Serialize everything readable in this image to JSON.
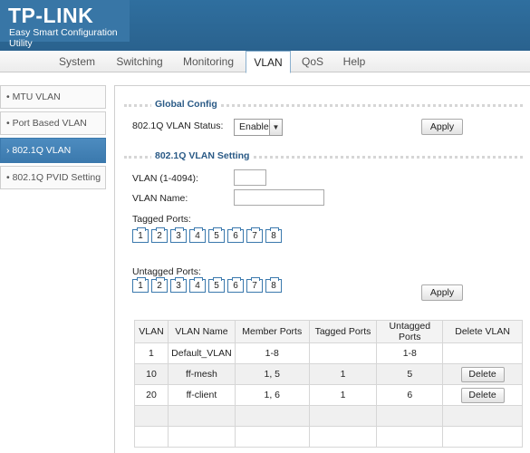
{
  "brand": {
    "logo": "TP-LINK",
    "subtitle": "Easy Smart Configuration Utility",
    "header_color": "#2f6f9f"
  },
  "tabs": [
    {
      "label": "System"
    },
    {
      "label": "Switching"
    },
    {
      "label": "Monitoring"
    },
    {
      "label": "VLAN",
      "active": true
    },
    {
      "label": "QoS"
    },
    {
      "label": "Help"
    }
  ],
  "menu": [
    {
      "label": "MTU VLAN"
    },
    {
      "label": "Port Based VLAN"
    },
    {
      "label": "802.1Q VLAN",
      "active": true
    },
    {
      "label": "802.1Q PVID Setting"
    }
  ],
  "global_config": {
    "title": "Global Config",
    "status_label": "802.1Q VLAN Status:",
    "status_value": "Enable",
    "apply_label": "Apply"
  },
  "vlan_setting": {
    "title": "802.1Q VLAN Setting",
    "vlan_id_label": "VLAN (1-4094):",
    "vlan_id_value": "",
    "vlan_name_label": "VLAN Name:",
    "vlan_name_value": "",
    "tagged_label": "Tagged Ports:",
    "untagged_label": "Untagged Ports:",
    "ports": [
      "1",
      "2",
      "3",
      "4",
      "5",
      "6",
      "7",
      "8"
    ],
    "apply_label": "Apply"
  },
  "table": {
    "headers": [
      "VLAN",
      "VLAN Name",
      "Member Ports",
      "Tagged Ports",
      "Untagged Ports",
      "Delete VLAN"
    ],
    "rows": [
      {
        "vlan": "1",
        "name": "Default_VLAN",
        "member": "1-8",
        "tagged": "",
        "untagged": "1-8",
        "delete": ""
      },
      {
        "vlan": "10",
        "name": "ff-mesh",
        "member": "1, 5",
        "tagged": "1",
        "untagged": "5",
        "delete": "Delete"
      },
      {
        "vlan": "20",
        "name": "ff-client",
        "member": "1, 6",
        "tagged": "1",
        "untagged": "6",
        "delete": "Delete"
      },
      {
        "vlan": "",
        "name": "",
        "member": "",
        "tagged": "",
        "untagged": "",
        "delete": ""
      },
      {
        "vlan": "",
        "name": "",
        "member": "",
        "tagged": "",
        "untagged": "",
        "delete": ""
      }
    ]
  },
  "colors": {
    "accent": "#3b79ad",
    "section_title": "#2a5a86"
  }
}
